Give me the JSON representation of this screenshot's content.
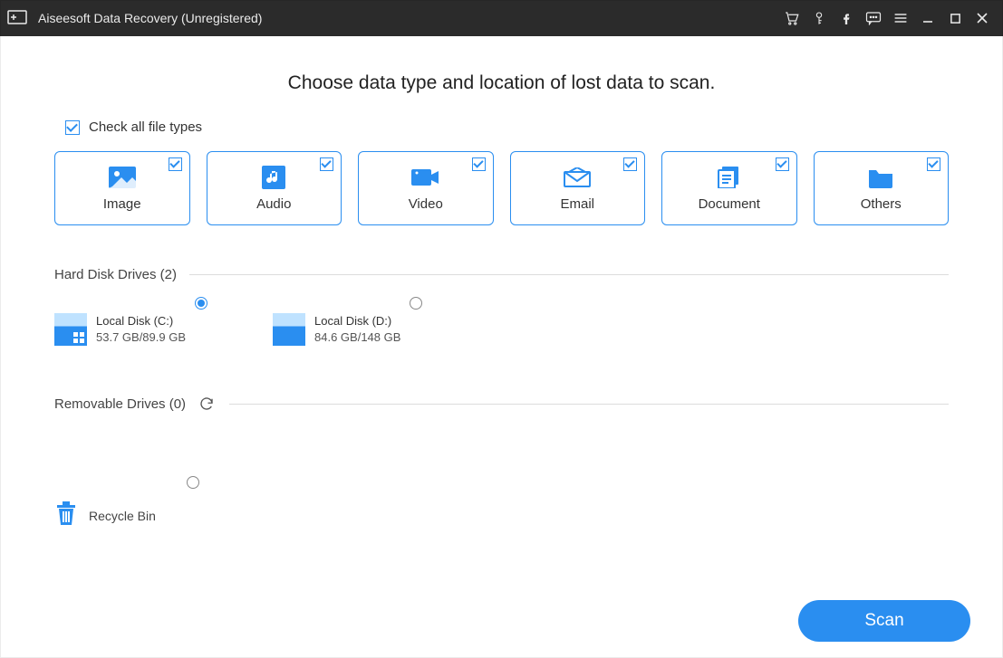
{
  "window": {
    "title": "Aiseesoft Data Recovery (Unregistered)"
  },
  "titlebarIcons": {
    "cart": "cart-icon",
    "key": "key-icon",
    "facebook": "facebook-icon",
    "feedback": "feedback-icon",
    "menu": "menu-icon",
    "minimize": "minimize-icon",
    "maximize": "maximize-icon",
    "close": "close-icon"
  },
  "heading": "Choose data type and location of lost data to scan.",
  "checkAll": {
    "label": "Check all file types",
    "checked": true
  },
  "types": [
    {
      "id": "image",
      "label": "Image",
      "checked": true
    },
    {
      "id": "audio",
      "label": "Audio",
      "checked": true
    },
    {
      "id": "video",
      "label": "Video",
      "checked": true
    },
    {
      "id": "email",
      "label": "Email",
      "checked": true
    },
    {
      "id": "document",
      "label": "Document",
      "checked": true
    },
    {
      "id": "others",
      "label": "Others",
      "checked": true
    }
  ],
  "sections": {
    "hdd": {
      "title": "Hard Disk Drives (2)"
    },
    "removable": {
      "title": "Removable Drives (0)"
    }
  },
  "drives": [
    {
      "name": "Local Disk (C:)",
      "usage": "53.7 GB/89.9 GB",
      "selected": true,
      "system": true
    },
    {
      "name": "Local Disk (D:)",
      "usage": "84.6 GB/148 GB",
      "selected": false,
      "system": false
    }
  ],
  "recycle": {
    "label": "Recycle Bin",
    "selected": false
  },
  "actions": {
    "scan": "Scan"
  },
  "colors": {
    "accent": "#2a8ef0",
    "titlebar": "#2b2b2b"
  }
}
